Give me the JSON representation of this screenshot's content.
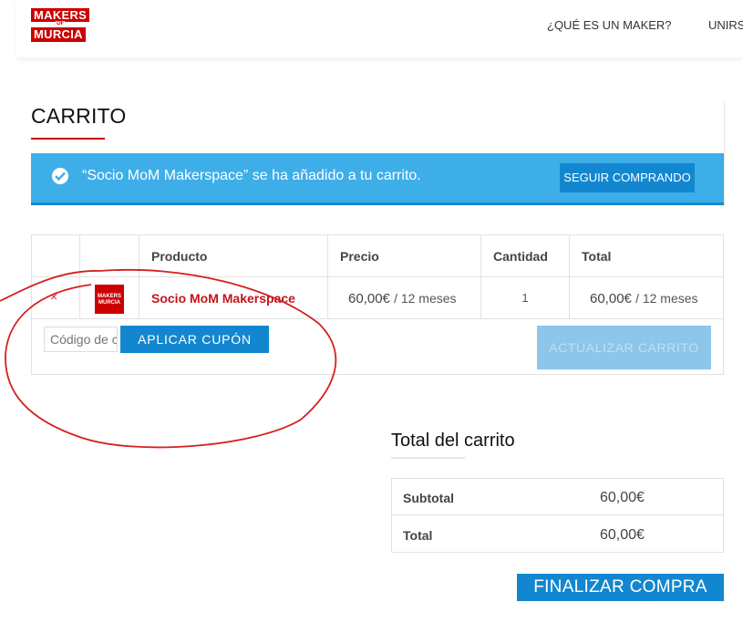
{
  "header": {
    "logo": {
      "line1": "MAKERS",
      "line2": "OF",
      "line3": "MURCIA",
      "color": "#cc0000"
    },
    "nav": [
      "¿QUÉ ES UN MAKER?",
      "UNIRS"
    ]
  },
  "page_title": "CARRITO",
  "notice": {
    "message": "“Socio MoM Makerspace” se ha añadido a tu carrito.",
    "button": "SEGUIR COMPRANDO",
    "bg_color": "#3eaee9"
  },
  "cart": {
    "headers": [
      "",
      "",
      "Producto",
      "Precio",
      "Cantidad",
      "Total"
    ],
    "items": [
      {
        "remove_symbol": "×",
        "thumb_text": "MAKERS MURCIA",
        "product": "Socio MoM Makerspace",
        "price": "60,00€",
        "price_period": "/ 12 meses",
        "quantity": "1",
        "total": "60,00€",
        "total_period": "/ 12 meses"
      }
    ],
    "coupon_placeholder": "Código de cupón",
    "apply_coupon": "APLICAR CUPÓN",
    "update_cart": "ACTUALIZAR CARRITO"
  },
  "totals": {
    "title": "Total del carrito",
    "rows": [
      {
        "label": "Subtotal",
        "value": "60,00€"
      },
      {
        "label": "Total",
        "value": "60,00€"
      }
    ],
    "checkout": "FINALIZAR COMPRA"
  },
  "colors": {
    "accent": "#1287cf",
    "brand_red": "#cc0000",
    "annotation": "#d42020"
  }
}
